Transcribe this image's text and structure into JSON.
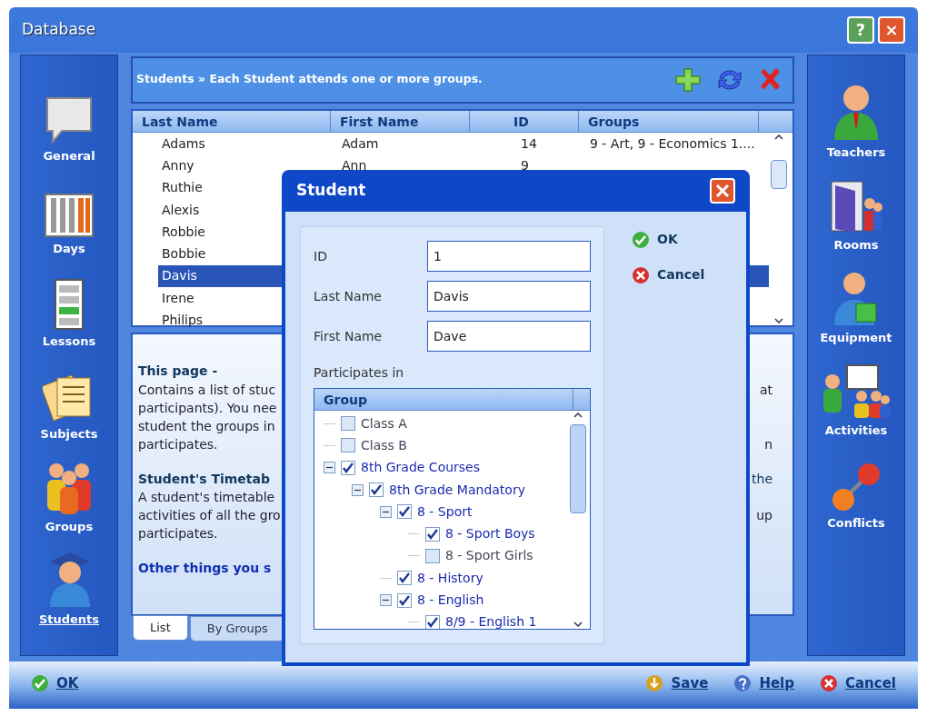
{
  "window": {
    "title": "Database",
    "buttons": [
      "?",
      "×"
    ]
  },
  "left_nav": [
    {
      "label": "General",
      "selected": false
    },
    {
      "label": "Days",
      "selected": false
    },
    {
      "label": "Lessons",
      "selected": false
    },
    {
      "label": "Subjects",
      "selected": false
    },
    {
      "label": "Groups",
      "selected": false
    },
    {
      "label": "Students",
      "selected": true
    }
  ],
  "right_nav": [
    {
      "label": "Teachers"
    },
    {
      "label": "Rooms"
    },
    {
      "label": "Equipment"
    },
    {
      "label": "Activities"
    },
    {
      "label": "Conflicts"
    }
  ],
  "header": {
    "text": "Students » Each Student attends one or more groups."
  },
  "table": {
    "columns": [
      "Last Name",
      "First Name",
      "ID",
      "Groups"
    ],
    "rows": [
      {
        "cells": [
          "Adams",
          "Adam",
          "14",
          "9 - Art, 9 - Economics 1...."
        ],
        "selected": false
      },
      {
        "cells": [
          "Anny",
          "Ann",
          "9",
          ""
        ],
        "selected": false
      },
      {
        "cells": [
          "Ruthie",
          "",
          "",
          ""
        ],
        "selected": false
      },
      {
        "cells": [
          "Alexis",
          "",
          "",
          ""
        ],
        "selected": false
      },
      {
        "cells": [
          "Robbie",
          "",
          "",
          ""
        ],
        "selected": false
      },
      {
        "cells": [
          "Bobbie",
          "",
          "",
          ""
        ],
        "selected": false
      },
      {
        "cells": [
          "Davis",
          "",
          "",
          ""
        ],
        "selected": true
      },
      {
        "cells": [
          "Irene",
          "",
          "",
          ""
        ],
        "selected": false
      },
      {
        "cells": [
          "Philips",
          "",
          "",
          ""
        ],
        "selected": false
      }
    ]
  },
  "help": {
    "lines": [
      {
        "kind": "heading",
        "left": "This page -"
      },
      {
        "kind": "text",
        "left": "Contains a list of stuc",
        "right": "at"
      },
      {
        "kind": "text",
        "left": "participants). You nee"
      },
      {
        "kind": "text",
        "left": "student the groups in"
      },
      {
        "kind": "text",
        "left": "participates.",
        "right": "n"
      },
      {
        "kind": "subheading",
        "left": "Student's Timetab",
        "right": "the"
      },
      {
        "kind": "text",
        "left": "A student's timetable"
      },
      {
        "kind": "text",
        "left": "activities of all the gro",
        "right": "up"
      },
      {
        "kind": "text",
        "left": "participates."
      },
      {
        "kind": "link",
        "left": "Other things you s"
      }
    ]
  },
  "tabs": [
    {
      "label": "List",
      "selected": true
    },
    {
      "label": "By Groups",
      "selected": false
    }
  ],
  "dialog": {
    "title": "Student",
    "fields": [
      {
        "label": "ID",
        "value": "1"
      },
      {
        "label": "Last Name",
        "value": "Davis"
      },
      {
        "label": "First Name",
        "value": "Dave"
      }
    ],
    "participates_label": "Participates in",
    "tree_header": "Group",
    "tree": [
      {
        "label": "Class A",
        "checked": false
      },
      {
        "label": "Class B",
        "checked": false
      },
      {
        "label": "8th Grade Courses",
        "checked": true,
        "expanded": true,
        "children": [
          {
            "label": "8th Grade Mandatory",
            "checked": true,
            "expanded": true,
            "children": [
              {
                "label": "8 - Sport",
                "checked": true,
                "expanded": true,
                "children": [
                  {
                    "label": "8 - Sport Boys",
                    "checked": true
                  },
                  {
                    "label": "8 - Sport Girls",
                    "checked": false
                  }
                ]
              },
              {
                "label": "8 - History",
                "checked": true
              },
              {
                "label": "8 - English",
                "checked": true,
                "expanded": true,
                "children": [
                  {
                    "label": "8/9 - English 1",
                    "checked": true
                  }
                ]
              }
            ]
          }
        ]
      }
    ],
    "buttons": [
      "OK",
      "Cancel"
    ]
  },
  "footer": {
    "left": "OK",
    "right": [
      "Save",
      "Help",
      "Cancel"
    ]
  }
}
